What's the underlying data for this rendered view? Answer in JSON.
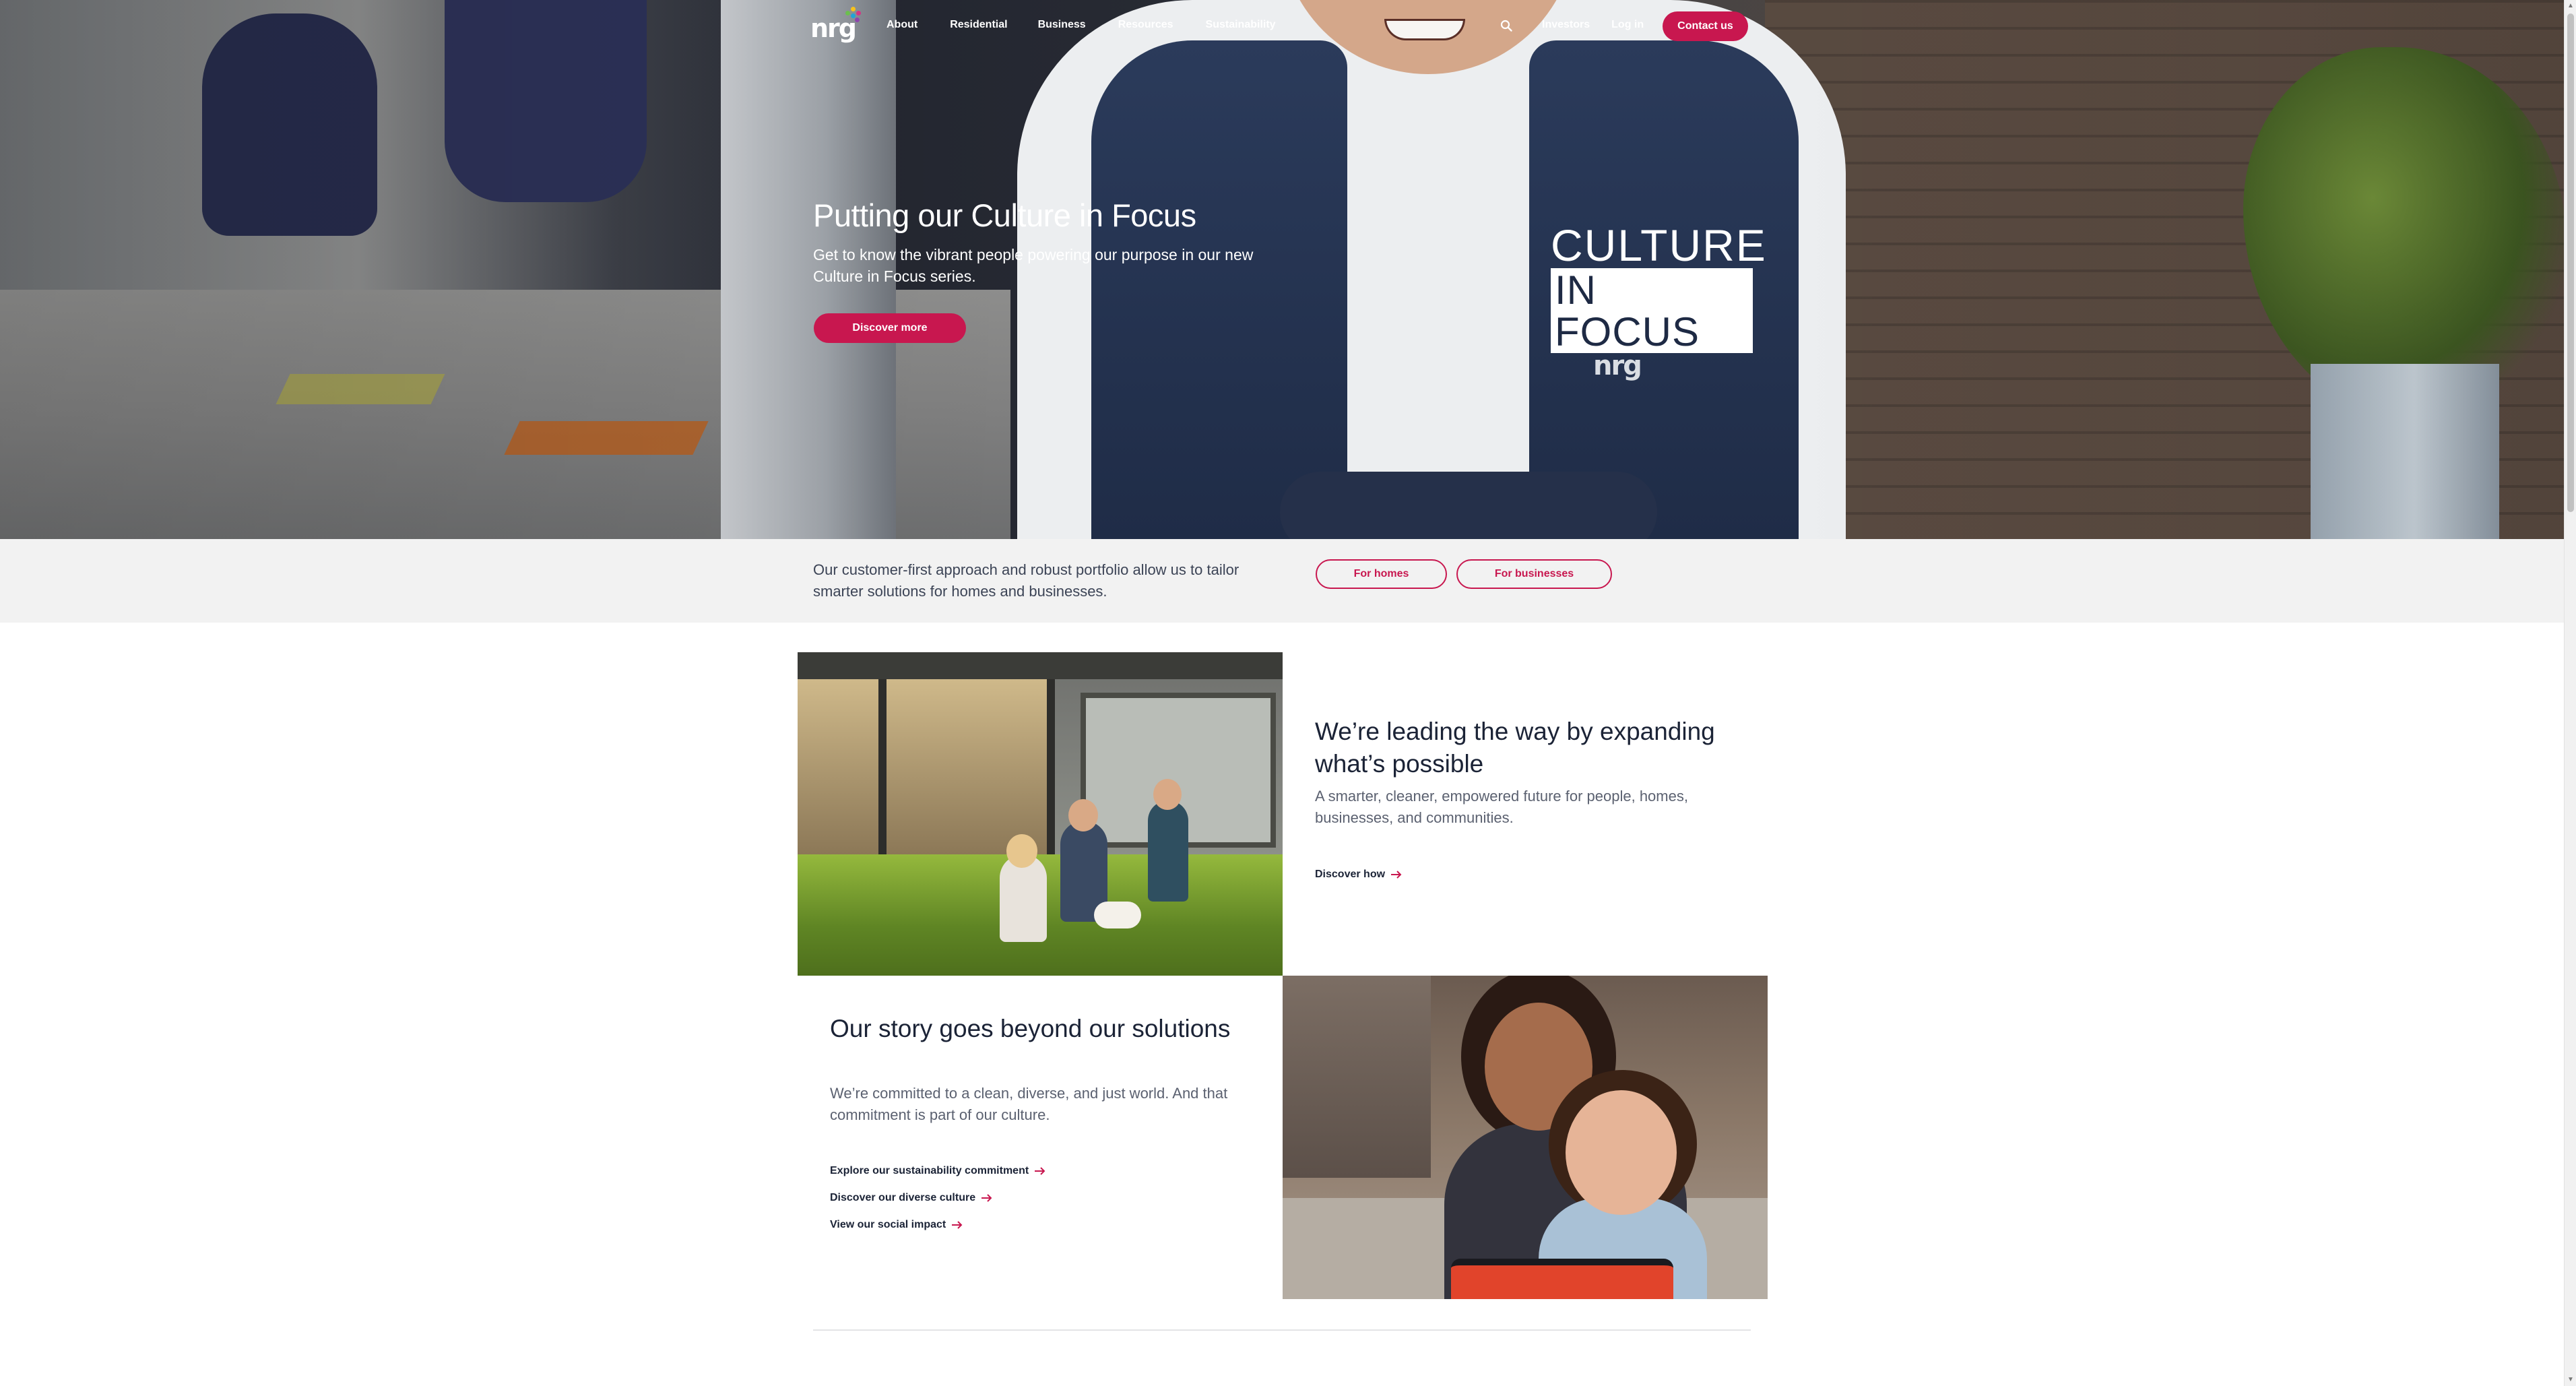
{
  "nav": {
    "logo": "nrg",
    "links": [
      "About",
      "Residential",
      "Business",
      "Resources",
      "Sustainability"
    ],
    "right_links": [
      "Investors",
      "Log in"
    ],
    "contact_label": "Contact us"
  },
  "hero": {
    "title": "Putting our Culture in Focus",
    "subtitle": "Get to know the vibrant people powering our purpose in our new Culture in Focus series.",
    "button_label": "Discover more",
    "badge_top": "CULTURE",
    "badge_bottom": "IN FOCUS",
    "vest_logo": "nrg"
  },
  "band": {
    "text": "Our customer-first approach and robust portfolio allow us to tailor smarter solutions for homes and businesses.",
    "homes_label": "For homes",
    "business_label": "For businesses"
  },
  "feature_one": {
    "title": "We’re leading the way by expanding what’s possible",
    "body": "A smarter, cleaner, empowered future for people, homes, businesses, and communities.",
    "link": "Discover how"
  },
  "feature_two": {
    "title": "Our story goes beyond our solutions",
    "body": "We’re committed to a clean, diverse, and just world. And that commitment is part of our culture.",
    "links": [
      "Explore our sustainability commitment",
      "Discover our diverse culture",
      "View our social impact"
    ]
  },
  "colors": {
    "accent": "#c8174f",
    "heading": "#1b2336",
    "band_bg": "#f2f2f2"
  },
  "icons": [
    "search-icon",
    "arrow-right-icon",
    "logo-spark-icon"
  ]
}
